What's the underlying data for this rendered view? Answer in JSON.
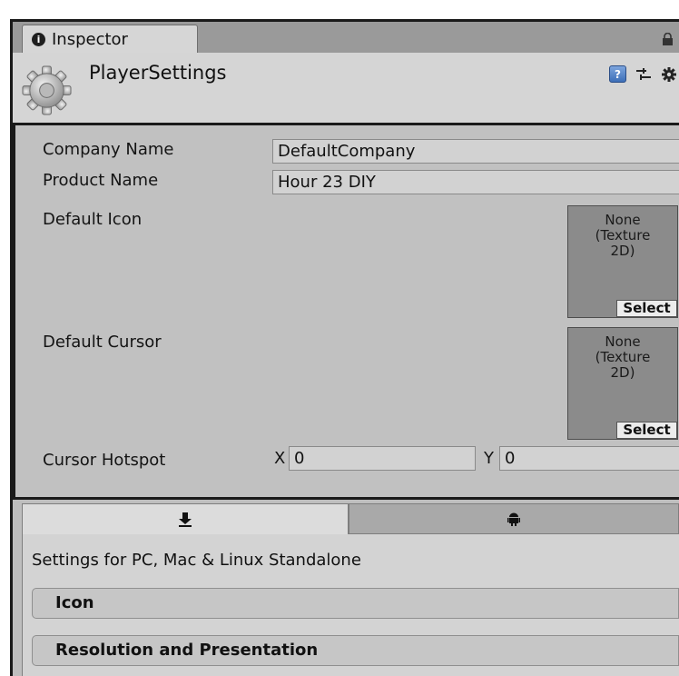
{
  "window": {
    "tab_label": "Inspector"
  },
  "header": {
    "title": "PlayerSettings",
    "help_glyph": "?"
  },
  "fields": {
    "company_name": {
      "label": "Company Name",
      "value": "DefaultCompany"
    },
    "product_name": {
      "label": "Product Name",
      "value": "Hour 23 DIY"
    },
    "default_icon": {
      "label": "Default Icon",
      "slot_text": "None\n(Texture\n2D)",
      "select_label": "Select"
    },
    "default_cursor": {
      "label": "Default Cursor",
      "slot_text": "None\n(Texture\n2D)",
      "select_label": "Select"
    },
    "cursor_hotspot": {
      "label": "Cursor Hotspot",
      "x_label": "X",
      "x_value": "0",
      "y_label": "Y",
      "y_value": "0"
    }
  },
  "platform_tabs": [
    {
      "icon": "download-arrow-icon",
      "selected": true
    },
    {
      "icon": "android-icon",
      "selected": false
    }
  ],
  "platform_settings": {
    "title": "Settings for PC, Mac & Linux Standalone",
    "sections": [
      {
        "label": "Icon"
      },
      {
        "label": "Resolution and Presentation"
      }
    ]
  }
}
